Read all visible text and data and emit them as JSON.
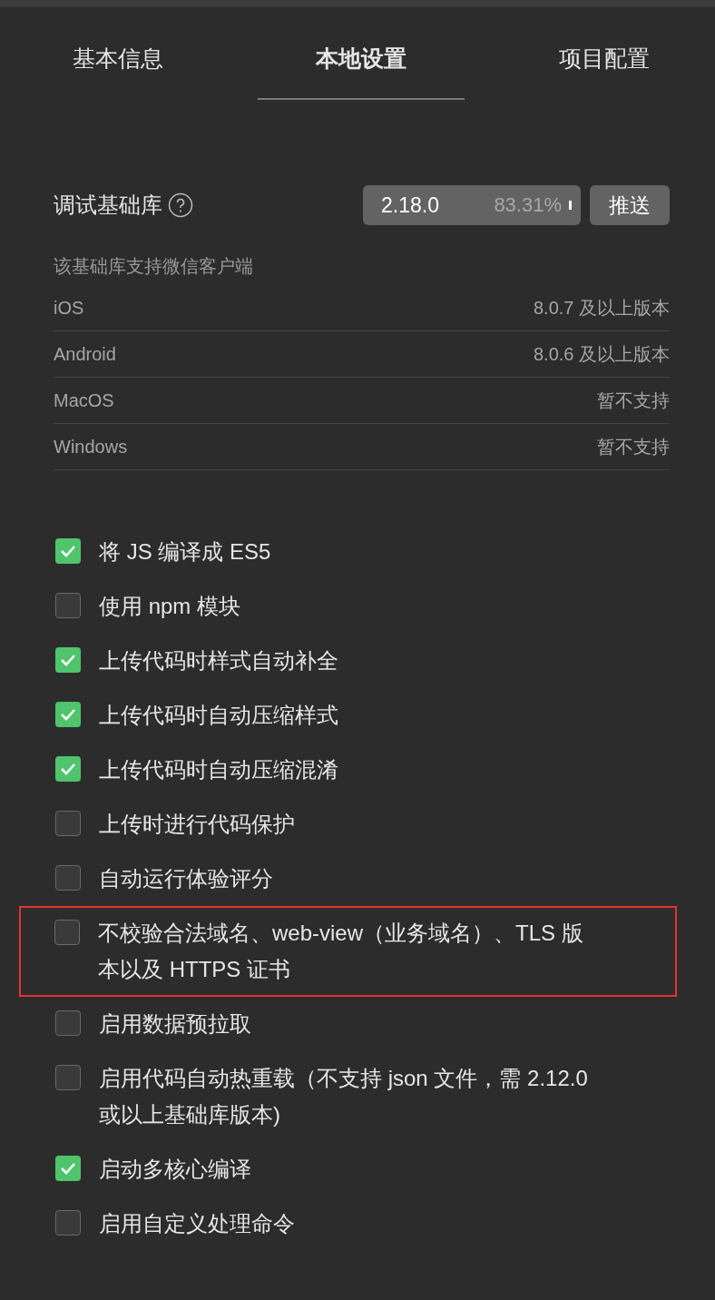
{
  "tabs": [
    {
      "label": "基本信息",
      "selected": false
    },
    {
      "label": "本地设置",
      "selected": true
    },
    {
      "label": "项目配置",
      "selected": false
    }
  ],
  "debug_library": {
    "label": "调试基础库",
    "version": "2.18.0",
    "usage": "83.31%",
    "push_button": "推送"
  },
  "support": {
    "heading": "该基础库支持微信客户端",
    "rows": [
      {
        "platform": "iOS",
        "requirement": "8.0.7 及以上版本"
      },
      {
        "platform": "Android",
        "requirement": "8.0.6 及以上版本"
      },
      {
        "platform": "MacOS",
        "requirement": "暂不支持"
      },
      {
        "platform": "Windows",
        "requirement": "暂不支持"
      }
    ]
  },
  "options": [
    {
      "label": "将 JS 编译成 ES5",
      "checked": true,
      "highlighted": false
    },
    {
      "label": "使用 npm 模块",
      "checked": false,
      "highlighted": false
    },
    {
      "label": "上传代码时样式自动补全",
      "checked": true,
      "highlighted": false
    },
    {
      "label": "上传代码时自动压缩样式",
      "checked": true,
      "highlighted": false
    },
    {
      "label": "上传代码时自动压缩混淆",
      "checked": true,
      "highlighted": false
    },
    {
      "label": "上传时进行代码保护",
      "checked": false,
      "highlighted": false
    },
    {
      "label": "自动运行体验评分",
      "checked": false,
      "highlighted": false
    },
    {
      "label": "不校验合法域名、web-view（业务域名）、TLS 版本以及 HTTPS 证书",
      "checked": false,
      "highlighted": true
    },
    {
      "label": "启用数据预拉取",
      "checked": false,
      "highlighted": false
    },
    {
      "label": "启用代码自动热重载（不支持 json 文件，需 2.12.0 或以上基础库版本)",
      "checked": false,
      "highlighted": false
    },
    {
      "label": "启动多核心编译",
      "checked": true,
      "highlighted": false
    },
    {
      "label": "启用自定义处理命令",
      "checked": false,
      "highlighted": false
    }
  ]
}
